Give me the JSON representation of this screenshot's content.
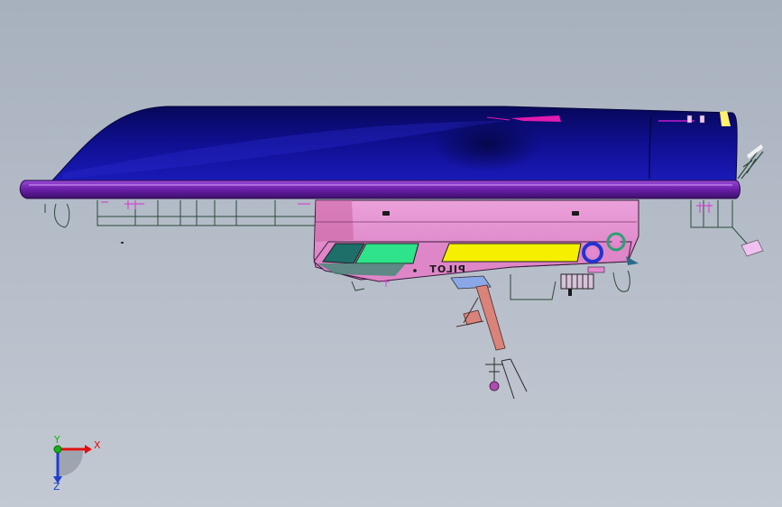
{
  "viewport": {
    "background_top": "#a7b0bd",
    "background_bottom": "#c3c9d2"
  },
  "model": {
    "hull_label": "PILOT",
    "colors": {
      "deck": "#0c0c6e",
      "deck_highlight": "#1a1aa8",
      "rubbing_strake": "#6a1fa8",
      "superstructure": "#e58ad0",
      "panel_teal": "#1e6e6a",
      "panel_green": "#2ee38a",
      "panel_yellow": "#f4f000",
      "outline": "#1b1b1b",
      "railing": "#2c4a3a",
      "mast": "#d9837a"
    }
  },
  "triad": {
    "x_label": "X",
    "y_label": "Y",
    "z_label": "Z",
    "x_color": "#e01010",
    "y_color": "#18b018",
    "z_color": "#1d3fd0"
  }
}
